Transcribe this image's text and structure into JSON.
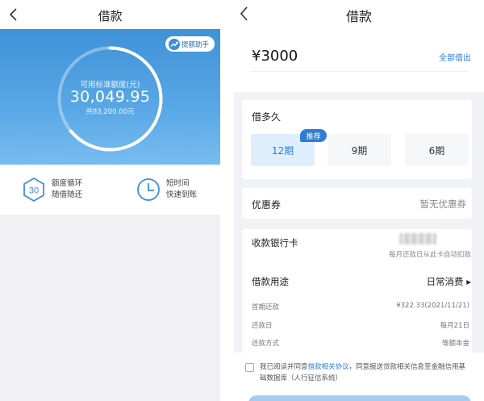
{
  "left": {
    "header": {
      "title": "借款"
    },
    "boost_button": {
      "label": "提额助手",
      "icon": "boost-icon"
    },
    "credit": {
      "label": "可用标准额度(元)",
      "amount": "30,049.95",
      "total": "共83,200.00元",
      "usage_fraction": 0.64
    },
    "features": [
      {
        "icon": "30-hexagon-icon",
        "badge": "30",
        "line1": "额度循环",
        "line2": "随借随还"
      },
      {
        "icon": "clock-icon",
        "line1": "短时间",
        "line2": "快速到账"
      }
    ]
  },
  "right": {
    "header": {
      "title": "借款"
    },
    "amount": "¥3000",
    "borrow_all_label": "全部借出",
    "term": {
      "title": "借多久",
      "recommended_badge": "推荐",
      "options": [
        {
          "label": "12期",
          "selected": true
        },
        {
          "label": "9期",
          "selected": false
        },
        {
          "label": "6期",
          "selected": false
        }
      ]
    },
    "coupon": {
      "label": "优惠券",
      "value": "暂无优惠券"
    },
    "bank": {
      "label": "收款银行卡",
      "note": "每月还款日从此卡自动扣款"
    },
    "purpose": {
      "label": "借款用途",
      "value": "日常消费 ▸"
    },
    "details": [
      {
        "label": "首期还款",
        "value": "¥322.33(2021/11/21)"
      },
      {
        "label": "还款日",
        "value": "每月21日"
      },
      {
        "label": "还款方式",
        "value": "等额本金"
      }
    ],
    "agreement": {
      "prefix": "我已阅读并同意",
      "link": "借款相关协议",
      "suffix": "，同意报送贷款相关信息至金融信用基础数据库（人行征信系统）"
    }
  },
  "colors": {
    "brand_blue": "#2f7cd8",
    "hero_top": "#3f92d8",
    "hero_bottom": "#77bdf0",
    "selected_term_bg": "#deeefd",
    "submit_disabled": "#a9cbf2"
  }
}
